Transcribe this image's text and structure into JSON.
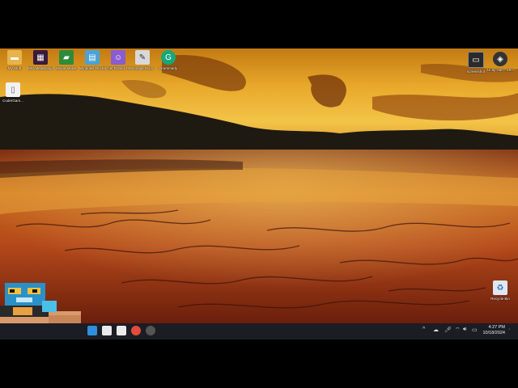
{
  "desktop": {
    "icons_left": [
      {
        "label": "My Stuff",
        "icon": "folder-icon",
        "color": "#e8b34a"
      },
      {
        "label": "MSVideoBackground Colors",
        "icon": "app-icon",
        "color": "#3a1a3a"
      },
      {
        "label": "Movie Maker",
        "icon": "clapper-icon",
        "color": "#2e8b3a"
      },
      {
        "label": "Windows File Explorer ...",
        "icon": "explorer-icon",
        "color": "#4aa3d8"
      },
      {
        "label": "Chef Roblox Player",
        "icon": "roblox-icon",
        "color": "#8a5cd0"
      },
      {
        "label": "Google Docs",
        "icon": "docs-icon",
        "color": "#d8d8d8"
      },
      {
        "label": "Grammarly",
        "icon": "grammarly-icon",
        "color": "#15a87a"
      }
    ],
    "icons_left_row2": [
      {
        "label": "CoderGam...",
        "icon": "document-icon",
        "color": "#f2f2f2"
      }
    ],
    "icons_right": [
      {
        "label": "screenshot",
        "icon": "image-icon",
        "color": "#2a2a2a"
      },
      {
        "label": "Unity Hub - Shortcut",
        "icon": "unity-icon",
        "color": "#333333"
      }
    ],
    "recycle_bin": {
      "label": "Recycle Bin",
      "icon": "recycle-bin-icon"
    }
  },
  "taskbar": {
    "pinned": [
      {
        "name": "file-explorer-icon",
        "color": "#2f8fdc"
      },
      {
        "name": "notepad-icon",
        "color": "#e9e9e9"
      },
      {
        "name": "capcut-icon",
        "color": "#eaeaea"
      },
      {
        "name": "chrome-icon",
        "color": "#e34b3b"
      },
      {
        "name": "unity-icon",
        "color": "#555555"
      }
    ],
    "tray": {
      "chevron": "^",
      "time": "4:27 PM",
      "date": "10/18/2024"
    }
  }
}
